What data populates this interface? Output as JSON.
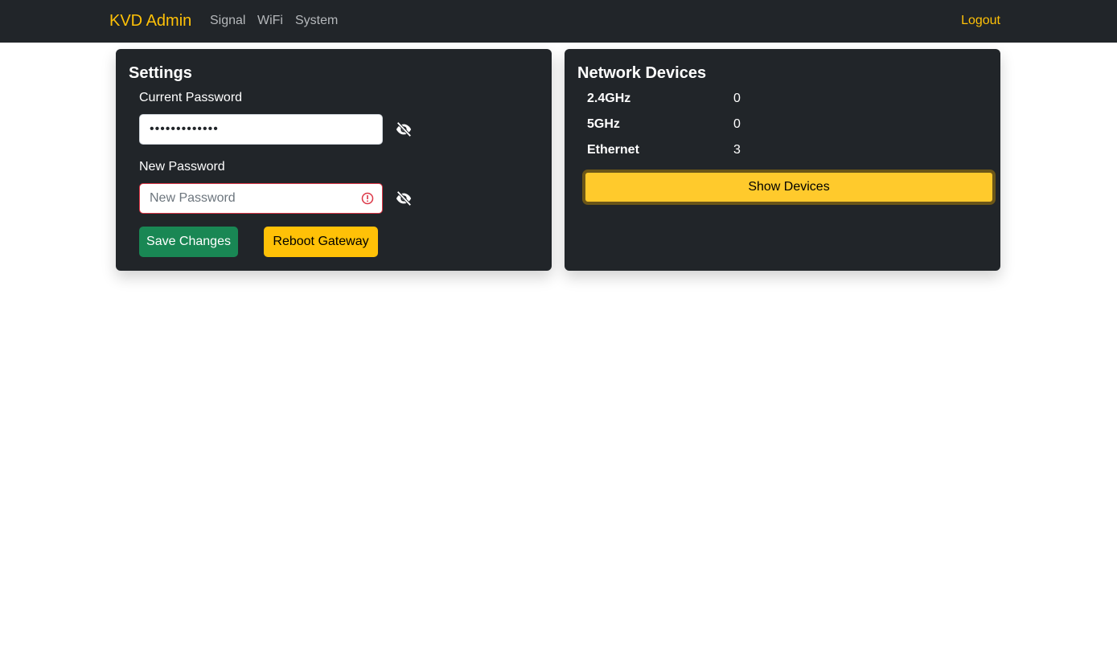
{
  "navbar": {
    "brand": "KVD Admin",
    "links": [
      "Signal",
      "WiFi",
      "System"
    ],
    "logout": "Logout"
  },
  "settings": {
    "title": "Settings",
    "current_password_label": "Current Password",
    "current_password_value": "•••••••••••••",
    "new_password_label": "New Password",
    "new_password_placeholder": "New Password",
    "save_label": "Save Changes",
    "reboot_label": "Reboot Gateway"
  },
  "devices": {
    "title": "Network Devices",
    "rows": [
      {
        "name": "2.4GHz",
        "count": "0"
      },
      {
        "name": "5GHz",
        "count": "0"
      },
      {
        "name": "Ethernet",
        "count": "3"
      }
    ],
    "show_label": "Show Devices"
  },
  "icons": {
    "toggle_visibility": "eye-slash-icon",
    "invalid": "exclamation-circle-icon"
  },
  "colors": {
    "accent": "#ffc107",
    "navbar_bg": "#212529",
    "success": "#198754",
    "danger": "#dc3545"
  }
}
